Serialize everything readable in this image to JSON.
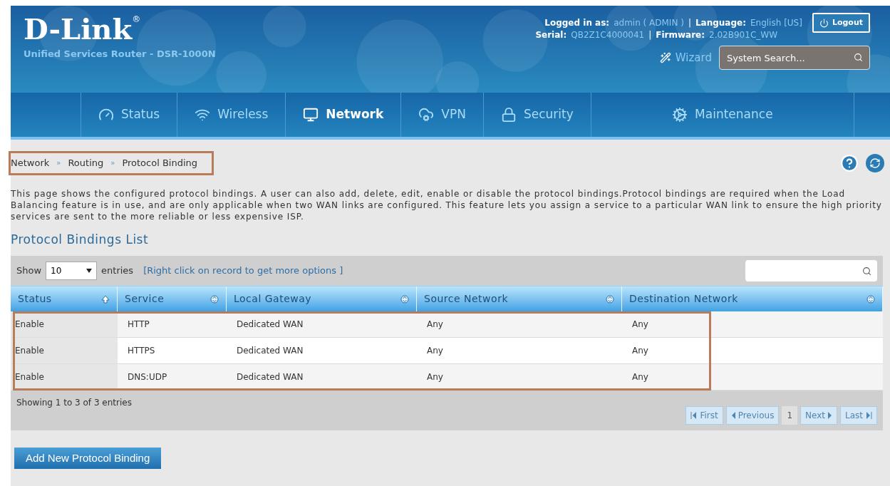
{
  "brand": {
    "logo": "D-Link",
    "registered": "®",
    "subtitle": "Unified Services Router - DSR-1000N"
  },
  "session": {
    "logged_label": "Logged in as:",
    "user": "admin ( ADMIN )",
    "language_label": "Language:",
    "language": "English [US]",
    "serial_label": "Serial:",
    "serial": "QB2Z1C4000041",
    "firmware_label": "Firmware:",
    "firmware": "2.02B901C_WW",
    "separators": [
      "|",
      "|"
    ],
    "logout": "Logout",
    "wizard": "Wizard",
    "search_placeholder": "System Search..."
  },
  "nav": [
    {
      "label": "Status",
      "selected": false
    },
    {
      "label": "Wireless",
      "selected": false
    },
    {
      "label": "Network",
      "selected": true
    },
    {
      "label": "VPN",
      "selected": false
    },
    {
      "label": "Security",
      "selected": false
    },
    {
      "label": "Maintenance",
      "selected": false
    }
  ],
  "breadcrumb": {
    "highlighted": true,
    "separator": "»",
    "items": [
      "Network",
      "Routing",
      "Protocol Binding"
    ]
  },
  "description": "This page shows the configured protocol bindings. A user can also add, delete, edit, enable or disable the protocol bindings.Protocol bindings are required when the Load Balancing feature is in use, and are only applicable when two WAN links are configured. This feature lets you assign a service to a particular WAN link to ensure the high priority services are sent to the more reliable or less expensive ISP.",
  "section_title": "Protocol Bindings List",
  "table": {
    "show_label": "Show",
    "page_size": "10",
    "entries_label": "entries",
    "hint": "[Right click on record to get more options ]",
    "columns": [
      {
        "label": "Status",
        "sorted": true
      },
      {
        "label": "Service",
        "sorted": false
      },
      {
        "label": "Local Gateway",
        "sorted": false
      },
      {
        "label": "Source Network",
        "sorted": false
      },
      {
        "label": "Destination Network",
        "sorted": false
      }
    ],
    "rows_highlighted": true,
    "rows": [
      [
        "Enable",
        "HTTP",
        "Dedicated WAN",
        "Any",
        "Any"
      ],
      [
        "Enable",
        "HTTPS",
        "Dedicated WAN",
        "Any",
        "Any"
      ],
      [
        "Enable",
        "DNS:UDP",
        "Dedicated WAN",
        "Any",
        "Any"
      ]
    ],
    "info": "Showing 1 to 3 of 3 entries",
    "pager": [
      {
        "label": "First",
        "kind": "first",
        "disabled": true
      },
      {
        "label": "Previous",
        "kind": "prev",
        "disabled": true
      },
      {
        "label": "1",
        "kind": "page"
      },
      {
        "label": "Next",
        "kind": "next",
        "disabled": true
      },
      {
        "label": "Last",
        "kind": "last",
        "disabled": true
      }
    ]
  },
  "add_button": "Add New Protocol Binding"
}
